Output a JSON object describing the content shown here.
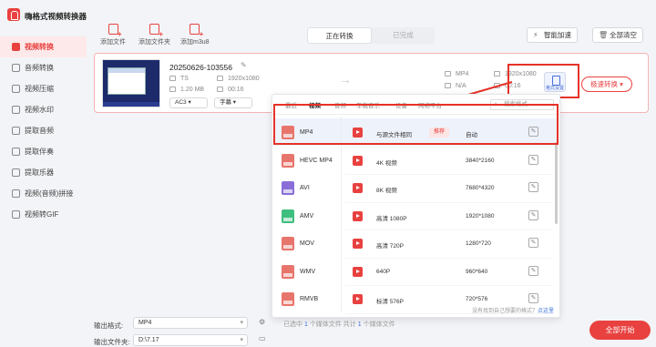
{
  "app": {
    "title": "嗨格式视频转换器"
  },
  "toolbar": {
    "add_file": "添加文件",
    "add_folder": "添加文件夹",
    "add_m3u8": "添加m3u8"
  },
  "tabs": {
    "converting": "正在转换",
    "done": "已完成"
  },
  "header": {
    "smart_accel": "智能加速",
    "clear_all": "全部清空"
  },
  "sidebar": {
    "items": [
      {
        "label": "视频转换",
        "active": true
      },
      {
        "label": "音频转换"
      },
      {
        "label": "视频压缩"
      },
      {
        "label": "视频水印"
      },
      {
        "label": "提取音频"
      },
      {
        "label": "提取伴奏"
      },
      {
        "label": "提取乐器"
      },
      {
        "label": "视频(音频)拼接"
      },
      {
        "label": "视频转GIF"
      }
    ]
  },
  "file": {
    "name": "20250626-103556",
    "src_format": "TS",
    "src_resolution": "1920x1080",
    "src_size": "1.20 MB",
    "src_duration": "00:16",
    "out_format": "MP4",
    "out_resolution": "1920x1080",
    "out_size": "N/A",
    "out_duration": "00:16",
    "audio": "AC3",
    "subtitle": "字幕",
    "format_settings": "格式设置",
    "speed_button": "极速转换"
  },
  "panel": {
    "tabs": [
      "最近",
      "视频",
      "音频",
      "车载音乐",
      "设备",
      "网络平台"
    ],
    "active_tab": "视频",
    "search_placeholder": "搜索格式",
    "formats": [
      {
        "label": "MP4",
        "color": "#e8756b"
      },
      {
        "label": "HEVC MP4",
        "color": "#e8756b"
      },
      {
        "label": "AVI",
        "color": "#8a6ed8"
      },
      {
        "label": "AMV",
        "color": "#3fbf7f"
      },
      {
        "label": "MOV",
        "color": "#e8756b"
      },
      {
        "label": "WMV",
        "color": "#e8756b"
      },
      {
        "label": "RMVB",
        "color": "#e8756b"
      }
    ],
    "resolutions": [
      {
        "name": "与源文件相同",
        "badge": "推荐",
        "value": "自动"
      },
      {
        "name": "4K 视频",
        "value": "3840*2160"
      },
      {
        "name": "8K 视频",
        "value": "7680*4320"
      },
      {
        "name": "高清 1080P",
        "value": "1920*1080"
      },
      {
        "name": "高清 720P",
        "value": "1280*720"
      },
      {
        "name": "640P",
        "value": "960*640"
      },
      {
        "name": "标清 576P",
        "value": "720*576"
      }
    ],
    "footer_text": "没有找到自己想要的格式？",
    "footer_link": "点这里"
  },
  "bottom": {
    "out_format_label": "输出格式:",
    "out_format_value": "MP4",
    "out_folder_label": "输出文件夹:",
    "out_folder_value": "D:\\7.17",
    "status_pre": "已选中",
    "status_selected": "1",
    "status_mid": "个媒体文件   共计",
    "status_total": "1",
    "status_post": "个媒体文件",
    "start_all": "全部开始"
  }
}
